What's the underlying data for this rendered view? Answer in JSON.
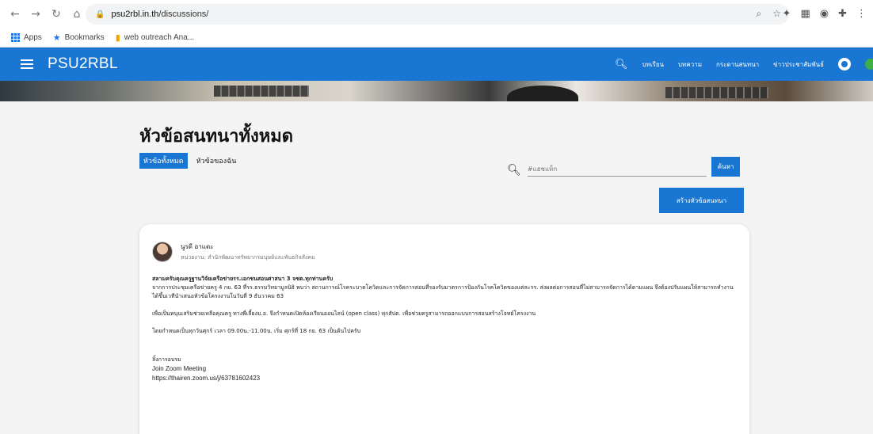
{
  "browser": {
    "url_host": "psu2rbl.in.th",
    "url_path": "/discussions/",
    "bookmarks": [
      "Apps",
      "Bookmarks",
      "web outreach Ana..."
    ]
  },
  "appbar": {
    "brand": "PSU2RBL",
    "nav": [
      "บทเรียน",
      "บทความ",
      "กระดานสนทนา",
      "ข่าวประชาสัมพันธ์"
    ]
  },
  "page": {
    "title": "หัวข้อสนทนาทั้งหมด",
    "tabs": [
      "หัวข้อทั้งหมด",
      "หัวข้อของฉัน"
    ],
    "search_placeholder": "#แฮชแท็ก",
    "search_button": "ค้นหา",
    "create_button": "สร้างหัวข้อสนทนา"
  },
  "post": {
    "author_name": "นูรดี อาแตะ",
    "author_org": "หน่วยงาน: สำนักพัฒนาทรัพยากรมนุษย์และพันธกิจสังคม",
    "greeting": "สลามครับคุณครูฐานวิจัยเครือข่ายรร.เอกชนสอนศาสนา 3 จชต.ทุกท่านครับ",
    "para1": "จากการประชุมเครือข่ายครู 4 กย. 63 ที่รร.ธรรมวิทยามูลนิธิ พบว่า สถานการณ์โรคระบาดโควิดและการจัดการสอนที่รองรับมาตรการป้องกันโรคโควิดของแต่ละรร. ส่งผลต่อการสอนที่ไม่สามารถจัดการได้ตามแผน จึงต้องปรับแผนให้สามารถทำงานได้ขึ้นเวทีนำเสนอหัวข้อโครงงานในวันที่ 9 ธันวาคม 63",
    "para2": "เพื่อเป็นหนุนเสริมช่วยเหลือคุณครู ทางพี่เลี้ยงม.อ. จึงกำหนดเปิดห้องเรียนออนไลน์ (open class) ทุกสัปด. เพื่อช่วยครูสามารถออกแบบการสอนสร้างโจทย์โครงงาน",
    "para3": "โดยกำหนดเป็นทุกวันศุกร์ เวลา 09.00น.-11.00น. เริ่ม ศุกร์ที่ 18 กย. 63 เป็นต้นไปครับ",
    "link_label": "ลิ้งการอบรม",
    "zoom_label": "Join Zoom Meeting",
    "zoom_url": "https://thairen.zoom.us/j/63781602423"
  }
}
